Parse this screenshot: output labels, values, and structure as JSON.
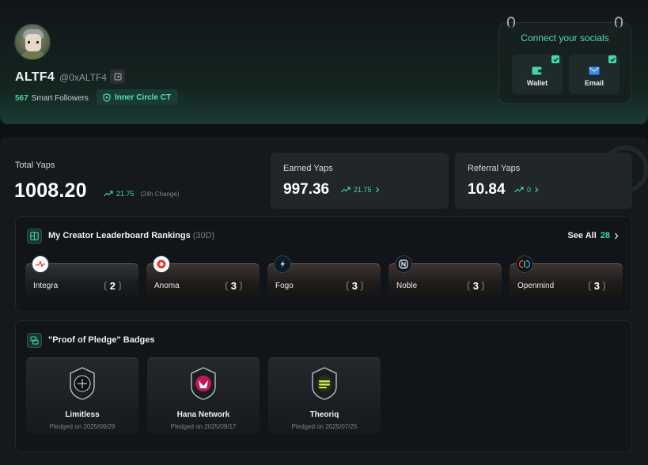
{
  "profile": {
    "name": "ALTF4",
    "handle": "@0xALTF4",
    "smart_followers_count": "567",
    "smart_followers_label": "Smart Followers",
    "badge": "Inner Circle CT"
  },
  "socials": {
    "title": "Connect your socials",
    "wallet_label": "Wallet",
    "email_label": "Email"
  },
  "yaps": {
    "total_label": "Total Yaps",
    "total_value": "1008.20",
    "total_change": "21.75",
    "total_change_note": "(24h Change)",
    "earned_label": "Earned Yaps",
    "earned_value": "997.36",
    "earned_change": "21.75",
    "referral_label": "Referral Yaps",
    "referral_value": "10.84",
    "referral_change": "0"
  },
  "leaderboard": {
    "title": "My Creator Leaderboard Rankings",
    "period": "(30D)",
    "see_all": "See All",
    "see_all_count": "28",
    "items": [
      {
        "name": "Integra",
        "rank": "2"
      },
      {
        "name": "Anoma",
        "rank": "3"
      },
      {
        "name": "Fogo",
        "rank": "3"
      },
      {
        "name": "Noble",
        "rank": "3"
      },
      {
        "name": "Openmind",
        "rank": "3"
      }
    ]
  },
  "badges": {
    "title": "\"Proof of Pledge\" Badges",
    "items": [
      {
        "name": "Limitless",
        "date": "Pledged on 2025/09/29"
      },
      {
        "name": "Hana Network",
        "date": "Pledged on 2025/09/17"
      },
      {
        "name": "Theoriq",
        "date": "Pledged on 2025/07/25"
      }
    ]
  },
  "colors": {
    "accent": "#46d6a6",
    "background": "#0e1014",
    "card": "#21262b"
  }
}
